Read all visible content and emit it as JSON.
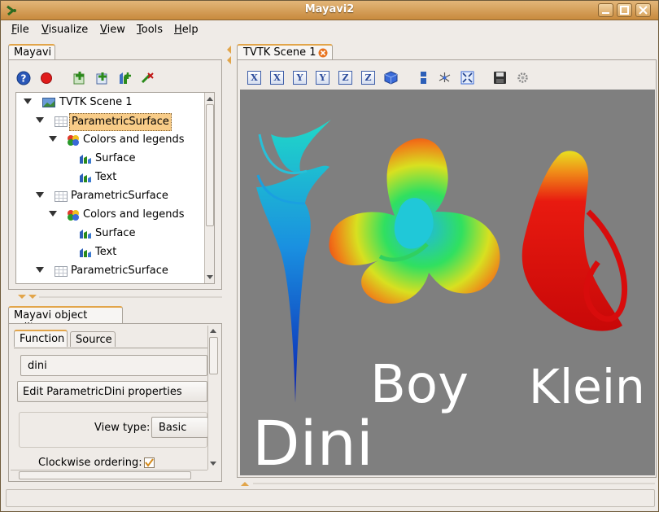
{
  "window": {
    "title": "Mayavi2"
  },
  "menubar": [
    {
      "label": "File",
      "u": "F",
      "rest": "ile"
    },
    {
      "label": "Visualize",
      "u": "V",
      "rest": "isualize"
    },
    {
      "label": "View",
      "u": "V",
      "rest": "iew"
    },
    {
      "label": "Tools",
      "u": "T",
      "rest": "ools"
    },
    {
      "label": "Help",
      "u": "H",
      "rest": "elp"
    }
  ],
  "left_panel": {
    "tab": "Mayavi",
    "tree": {
      "root": "TVTK Scene 1",
      "items": [
        {
          "label": "ParametricSurface"
        },
        {
          "label": "Colors and legends"
        },
        {
          "label": "Surface"
        },
        {
          "label": "Text"
        },
        {
          "label": "ParametricSurface"
        },
        {
          "label": "Colors and legends"
        },
        {
          "label": "Surface"
        },
        {
          "label": "Text"
        },
        {
          "label": "ParametricSurface"
        }
      ]
    }
  },
  "editor": {
    "tab": "Mayavi object editor",
    "subtabs": [
      "Function",
      "Source"
    ],
    "function_value": "dini",
    "edit_button": "Edit ParametricDini properties",
    "view_type_label": "View type:",
    "view_type_value": "Basic",
    "clockwise_label": "Clockwise ordering:",
    "clockwise_checked": true
  },
  "scene": {
    "tab": "TVTK Scene 1",
    "labels": {
      "dini": "Dini",
      "boy": "Boy",
      "klein": "Klein"
    },
    "background": "#7f7f7f"
  },
  "icons": [
    "app-icon",
    "help-icon",
    "record-icon",
    "add-data-icon",
    "add-filter-icon",
    "add-module-icon",
    "delete-icon",
    "view-x-icon",
    "view-y-icon",
    "view-z-icon",
    "iso-view-icon",
    "parallel-projection-icon",
    "axes-icon",
    "fullscreen-icon",
    "save-icon",
    "settings-icon"
  ]
}
